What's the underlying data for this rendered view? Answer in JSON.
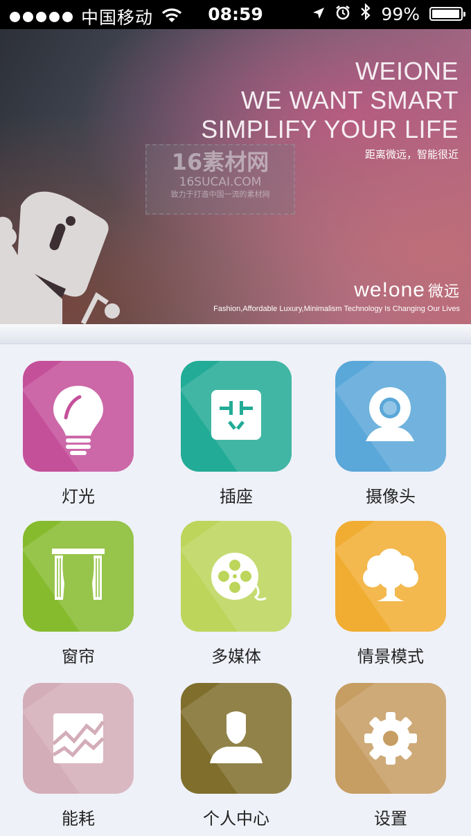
{
  "status_bar": {
    "carrier": "中国移动",
    "time": "08:59",
    "battery": "99%"
  },
  "banner": {
    "line1": "WEIONE",
    "line2": "WE WANT SMART",
    "line3": "SIMPLIFY YOUR LIFE",
    "subtitle": "距离微远，智能很近",
    "logo_text": "we!one",
    "logo_cn": "微远",
    "tagline": "Fashion,Affordable Luxury,Minimalism Technology Is Changing Our Lives",
    "watermark": {
      "title": "16素材网",
      "domain": "16SUCAI.COM",
      "slogan": "致力于打造中国一流的素材网"
    }
  },
  "tiles": [
    {
      "label": "灯光",
      "color": "#c4509a",
      "icon": "bulb-icon"
    },
    {
      "label": "插座",
      "color": "#22ab96",
      "icon": "socket-icon"
    },
    {
      "label": "摄像头",
      "color": "#5aa7d9",
      "icon": "camera-icon"
    },
    {
      "label": "窗帘",
      "color": "#86bb2e",
      "icon": "curtain-icon"
    },
    {
      "label": "多媒体",
      "color": "#bcd55a",
      "icon": "film-reel-icon"
    },
    {
      "label": "情景模式",
      "color": "#f1ad32",
      "icon": "tree-icon"
    },
    {
      "label": "能耗",
      "color": "#d3adb8",
      "icon": "chart-icon"
    },
    {
      "label": "个人中心",
      "color": "#7f6e2c",
      "icon": "person-icon"
    },
    {
      "label": "设置",
      "color": "#c69d62",
      "icon": "gear-icon"
    }
  ]
}
